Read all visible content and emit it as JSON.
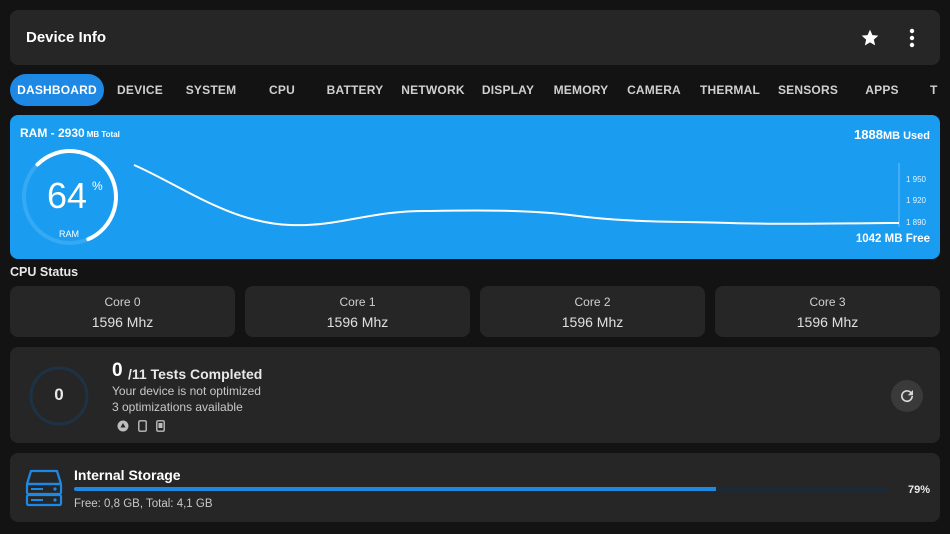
{
  "app": {
    "title": "Device Info"
  },
  "tabs": [
    {
      "label": "DASHBOARD",
      "active": true
    },
    {
      "label": "DEVICE"
    },
    {
      "label": "SYSTEM"
    },
    {
      "label": "CPU"
    },
    {
      "label": "BATTERY"
    },
    {
      "label": "NETWORK"
    },
    {
      "label": "DISPLAY"
    },
    {
      "label": "MEMORY"
    },
    {
      "label": "CAMERA"
    },
    {
      "label": "THERMAL"
    },
    {
      "label": "SENSORS"
    },
    {
      "label": "APPS"
    },
    {
      "label": "T"
    }
  ],
  "ram": {
    "label": "RAM - 2930",
    "label_unit": "MB Total",
    "used_value": "1888",
    "used_unit": "MB Used",
    "free_text": "1042  MB Free",
    "percent": "64",
    "percent_sign": "%",
    "gauge_label": "RAM",
    "gauge_fraction": 0.64,
    "chart_y_ticks": [
      "1 950",
      "1 920",
      "1 890"
    ]
  },
  "cpu": {
    "title": "CPU Status",
    "cores": [
      {
        "name": "Core 0",
        "freq": "1596 Mhz"
      },
      {
        "name": "Core 1",
        "freq": "1596 Mhz"
      },
      {
        "name": "Core 2",
        "freq": "1596 Mhz"
      },
      {
        "name": "Core 3",
        "freq": "1596 Mhz"
      }
    ]
  },
  "tests": {
    "completed": "0",
    "total_text": "/11 Tests Completed",
    "ring_value": "0",
    "status": "Your device is not optimized",
    "available": "3 optimizations available",
    "icons": [
      "android-icon",
      "phone-icon",
      "device-icon"
    ]
  },
  "storage": {
    "name": "Internal Storage",
    "percent_text": "79%",
    "fraction": 0.79,
    "info": "Free: 0,8 GB,  Total: 4,1 GB"
  },
  "colors": {
    "accent": "#1e88e5",
    "ram_card": "#1a9cf0",
    "card": "#262626",
    "background": "#131313"
  }
}
